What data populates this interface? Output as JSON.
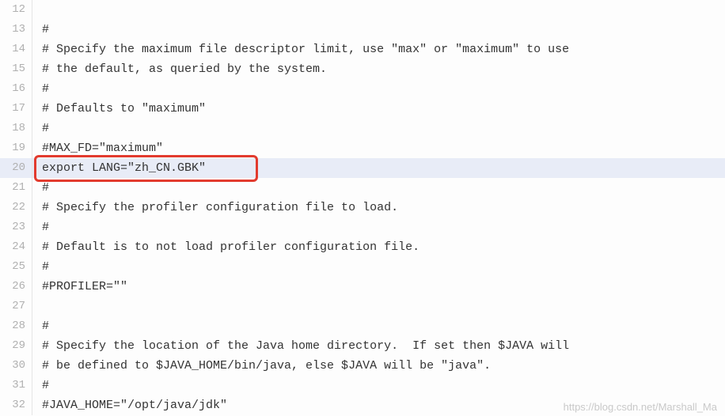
{
  "highlightedLine": 20,
  "lines": [
    {
      "num": 12,
      "text": ""
    },
    {
      "num": 13,
      "text": "#"
    },
    {
      "num": 14,
      "text": "# Specify the maximum file descriptor limit, use \"max\" or \"maximum\" to use"
    },
    {
      "num": 15,
      "text": "# the default, as queried by the system."
    },
    {
      "num": 16,
      "text": "#"
    },
    {
      "num": 17,
      "text": "# Defaults to \"maximum\""
    },
    {
      "num": 18,
      "text": "#"
    },
    {
      "num": 19,
      "text": "#MAX_FD=\"maximum\""
    },
    {
      "num": 20,
      "text": "export LANG=\"zh_CN.GBK\""
    },
    {
      "num": 21,
      "text": "#"
    },
    {
      "num": 22,
      "text": "# Specify the profiler configuration file to load."
    },
    {
      "num": 23,
      "text": "#"
    },
    {
      "num": 24,
      "text": "# Default is to not load profiler configuration file."
    },
    {
      "num": 25,
      "text": "#"
    },
    {
      "num": 26,
      "text": "#PROFILER=\"\""
    },
    {
      "num": 27,
      "text": ""
    },
    {
      "num": 28,
      "text": "#"
    },
    {
      "num": 29,
      "text": "# Specify the location of the Java home directory.  If set then $JAVA will"
    },
    {
      "num": 30,
      "text": "# be defined to $JAVA_HOME/bin/java, else $JAVA will be \"java\"."
    },
    {
      "num": 31,
      "text": "#"
    },
    {
      "num": 32,
      "text": "#JAVA_HOME=\"/opt/java/jdk\""
    }
  ],
  "watermark": "https://blog.csdn.net/Marshall_Ma"
}
